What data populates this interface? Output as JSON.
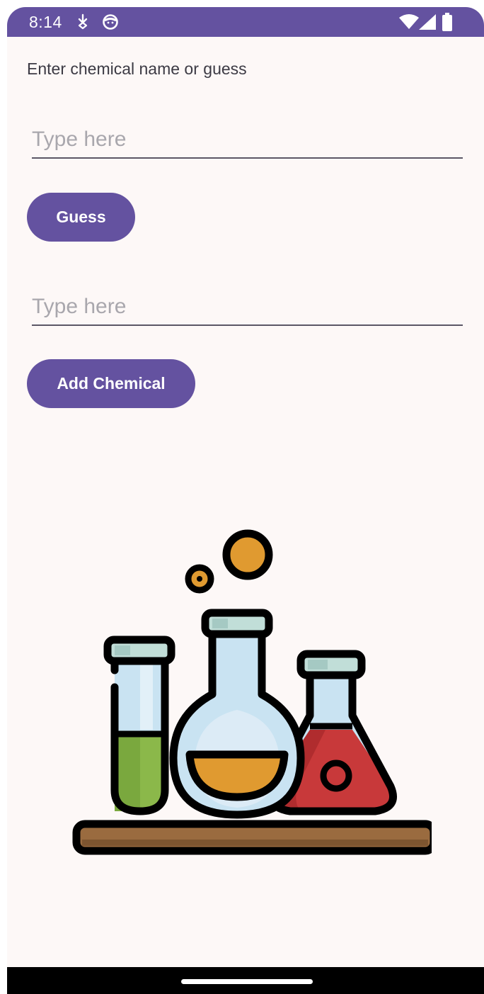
{
  "status_bar": {
    "time": "8:14",
    "notification_icons": [
      "download-icon",
      "smiley-icon"
    ],
    "system_icons": [
      "wifi-icon",
      "cell-signal-icon",
      "battery-icon"
    ],
    "color": "#6452a0"
  },
  "main": {
    "prompt_label": "Enter chemical name or guess",
    "guess_input": {
      "value": "",
      "placeholder": "Type here"
    },
    "guess_button_label": "Guess",
    "chemical_input": {
      "value": "",
      "placeholder": "Type here"
    },
    "add_chemical_button_label": "Add Chemical"
  },
  "illustration": {
    "icon": "chemistry-lab-glassware-icon",
    "colors": {
      "green_liquid": "#8bb84a",
      "orange_liquid": "#e09a30",
      "red_liquid": "#c8393a",
      "glass": "#c9e3f2",
      "shelf": "#9a6b3f"
    }
  },
  "theme": {
    "accent": "#6452a0",
    "background": "#fdf8f7"
  }
}
